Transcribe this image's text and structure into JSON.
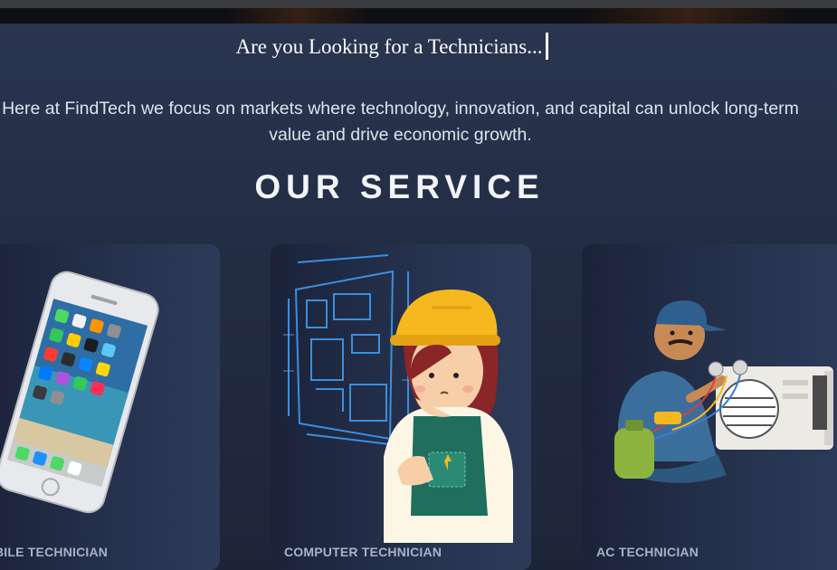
{
  "hero": {
    "typing_text": "Are you Looking for a Technicians...",
    "intro_text": "Here at FindTech we focus on markets where technology, innovation, and capital can unlock long-term value and drive economic growth."
  },
  "services": {
    "title": "OUR SERVICE",
    "cards": [
      {
        "label": "BILE TECHNICIAN",
        "image": "smartphone-illustration"
      },
      {
        "label": "COMPUTER TECHNICIAN",
        "image": "engineer-blueprint-illustration"
      },
      {
        "label": "AC TECHNICIAN",
        "image": "ac-repairman-illustration"
      }
    ]
  },
  "colors": {
    "background": "#222c43",
    "card": "#283552",
    "text": "#dde3ee",
    "helmet": "#f6b81f",
    "blueprint": "#3a8fe0"
  }
}
